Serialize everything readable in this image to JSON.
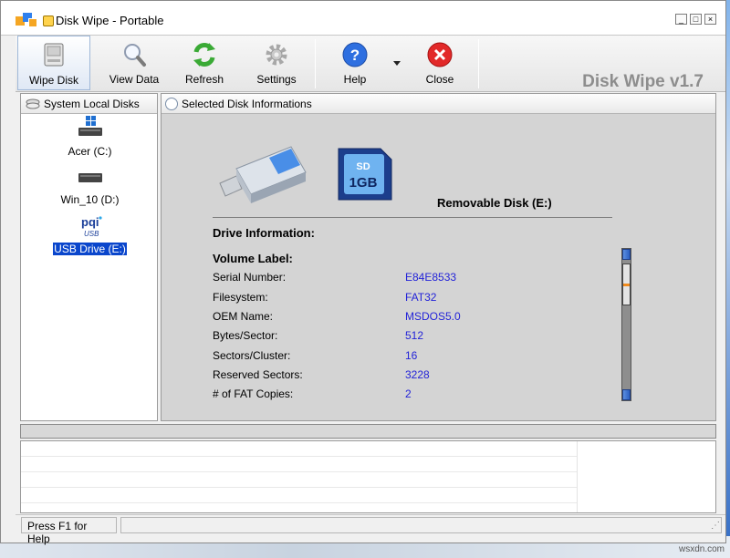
{
  "window": {
    "title": "Disk Wipe  - Portable"
  },
  "toolbar": {
    "items": [
      {
        "label": "Wipe Disk",
        "icon": "disk-wipe-icon"
      },
      {
        "label": "View Data",
        "icon": "magnifier-icon"
      },
      {
        "label": "Refresh",
        "icon": "refresh-icon"
      },
      {
        "label": "Settings",
        "icon": "gear-icon"
      },
      {
        "label": "Help",
        "icon": "help-icon"
      },
      {
        "label": "Close",
        "icon": "close-icon"
      }
    ],
    "brand": "Disk Wipe v1.7"
  },
  "left_panel": {
    "header": "System Local Disks",
    "disks": [
      {
        "label": "Acer (C:)",
        "icon": "windows-drive-icon"
      },
      {
        "label": "Win_10 (D:)",
        "icon": "hard-drive-icon"
      },
      {
        "label": "USB Drive (E:)",
        "icon": "pqi-usb-icon",
        "logo_text": "pqi",
        "logo_sub": "USB"
      }
    ]
  },
  "right_panel": {
    "header": "Selected Disk Informations",
    "sd_label_top": "SD",
    "sd_label": "1GB",
    "disk_title": "Removable Disk  (E:)",
    "drive_info_heading": "Drive Information:",
    "volume_label": "Volume Label:",
    "rows": [
      {
        "label": "Serial Number:",
        "value": "E84E8533"
      },
      {
        "label": "Filesystem:",
        "value": "FAT32"
      },
      {
        "label": "OEM Name:",
        "value": "MSDOS5.0"
      },
      {
        "label": "Bytes/Sector:",
        "value": "512"
      },
      {
        "label": "Sectors/Cluster:",
        "value": "16"
      },
      {
        "label": "Reserved Sectors:",
        "value": "3228"
      },
      {
        "label": "# of FAT Copies:",
        "value": "2"
      }
    ]
  },
  "status": {
    "text": "Press F1 for Help"
  },
  "colors": {
    "selection": "#0a46cc",
    "value_text": "#2323d8",
    "brand": "#8d8d8d"
  },
  "watermark": "wsxdn.com"
}
